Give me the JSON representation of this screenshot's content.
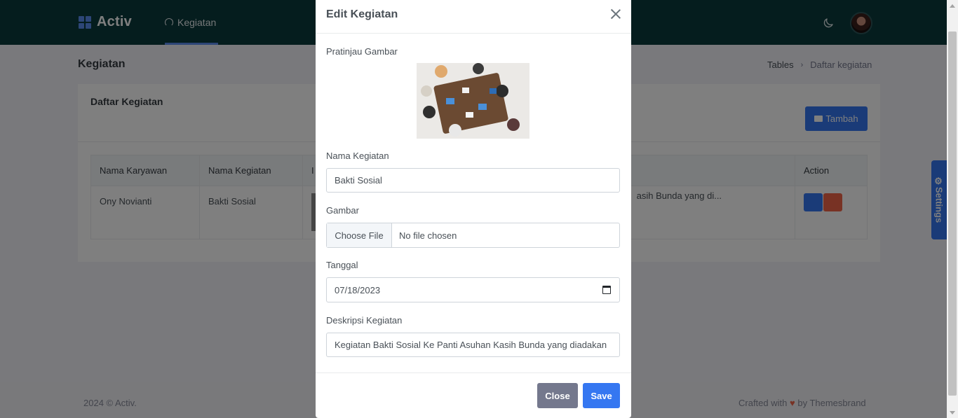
{
  "app": {
    "brand": "Activ",
    "nav_item": "Kegiatan"
  },
  "page": {
    "title": "Kegiatan",
    "breadcrumb": [
      "Tables",
      "Daftar kegiatan"
    ]
  },
  "card": {
    "title": "Daftar Kegiatan",
    "add_button": "Tambah",
    "table": {
      "headers": [
        "Nama Karyawan",
        "Nama Kegiatan",
        "I",
        "Action"
      ],
      "rows": [
        {
          "nama_karyawan": "Ony Novianti",
          "nama_kegiatan": "Bakti Sosial",
          "deskripsi_partial": "asih Bunda yang di..."
        }
      ]
    }
  },
  "settings_tab": "Settings",
  "footer": {
    "left": "2024 © Activ.",
    "right_prefix": "Crafted with",
    "right_suffix": "by Themesbrand"
  },
  "modal": {
    "title": "Edit Kegiatan",
    "preview_label": "Pratinjau Gambar",
    "nama_label": "Nama Kegiatan",
    "nama_value": "Bakti Sosial",
    "gambar_label": "Gambar",
    "file_button": "Choose File",
    "file_status": "No file chosen",
    "tanggal_label": "Tanggal",
    "tanggal_value": "07/18/2023",
    "deskripsi_label": "Deskripsi Kegiatan",
    "deskripsi_value": "Kegiatan Bakti Sosial Ke Panti Asuhan Kasih Bunda yang diadakan",
    "close_button": "Close",
    "save_button": "Save"
  },
  "colors": {
    "navbar": "#0b3b3d",
    "primary": "#3577f1",
    "danger": "#f06548",
    "secondary": "#74788d"
  },
  "icons": [
    "grid-logo-icon",
    "dashboard-icon",
    "moon-icon",
    "folder-icon",
    "edit-icon",
    "trash-icon",
    "gear-icon",
    "close-icon",
    "calendar-icon",
    "heart-icon"
  ]
}
